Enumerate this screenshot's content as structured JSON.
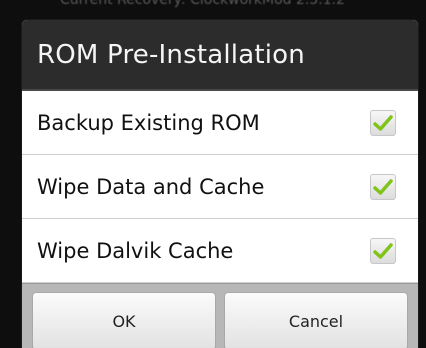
{
  "background": {
    "partial_text": "Current Recovery: ClockworkMod 2.5.1.2"
  },
  "dialog": {
    "title": "ROM Pre-Installation",
    "options": [
      {
        "label": "Backup Existing ROM",
        "checked": true
      },
      {
        "label": "Wipe Data and Cache",
        "checked": true
      },
      {
        "label": "Wipe Dalvik Cache",
        "checked": true
      }
    ],
    "buttons": {
      "ok": "OK",
      "cancel": "Cancel"
    }
  },
  "colors": {
    "check_green": "#7fc31c",
    "title_bg": "#2c2c2c"
  },
  "icons": {
    "checkbox": "checkmark-icon"
  }
}
